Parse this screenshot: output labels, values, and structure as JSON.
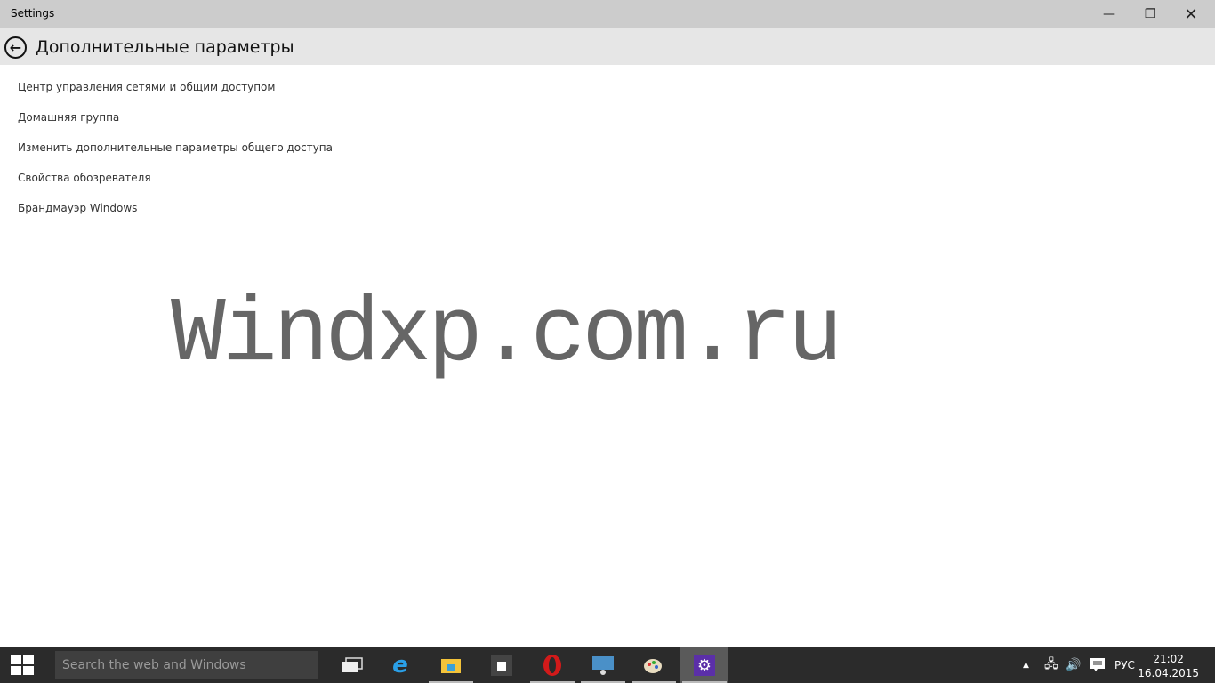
{
  "window": {
    "title": "Settings"
  },
  "header": {
    "title": "Дополнительные параметры"
  },
  "links": [
    "Центр управления сетями и общим доступом",
    "Домашняя группа",
    "Изменить дополнительные параметры общего доступа",
    "Свойства обозревателя",
    "Брандмауэр Windows"
  ],
  "watermark": "Windxp.com.ru",
  "taskbar": {
    "search_placeholder": "Search the web and Windows",
    "apps": [
      "task-view",
      "internet-explorer",
      "file-explorer",
      "store",
      "opera",
      "network-app",
      "paint",
      "settings"
    ],
    "language": "РУС",
    "time": "21:02",
    "date": "16.04.2015"
  },
  "colors": {
    "accent": "#5b2fa8",
    "taskbar": "#2b2b2b"
  }
}
